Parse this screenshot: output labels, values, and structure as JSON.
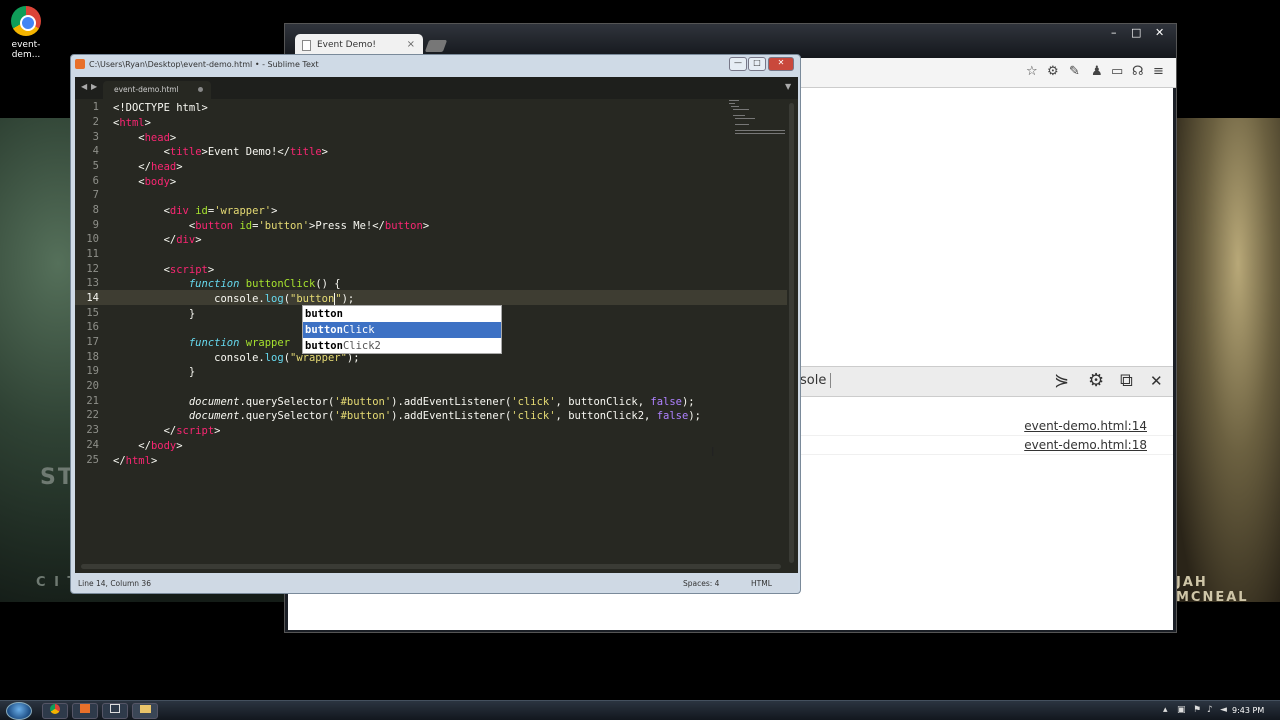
{
  "desktop": {
    "icon_label": "event-dem...",
    "wallpaper_text_left": "ST",
    "wallpaper_text_left2": "C I T",
    "wallpaper_text_right": "JAH MCNEAL"
  },
  "chrome": {
    "tab_title": "Event Demo!",
    "tab_close": "×",
    "win_min": "–",
    "win_max": "□",
    "win_close": "✕",
    "devtools": {
      "tab_label": "sole",
      "logs": [
        {
          "source": "event-demo.html:14"
        },
        {
          "source": "event-demo.html:18"
        }
      ]
    }
  },
  "sublime": {
    "title": "C:\\Users\\Ryan\\Desktop\\event-demo.html • - Sublime Text",
    "file_tab": "event-demo.html",
    "nav_back": "◀",
    "nav_fwd": "▶",
    "tab_dropdown": "▼",
    "btn_min": "—",
    "btn_max": "□",
    "btn_close": "✕",
    "line_numbers": [
      "1",
      "2",
      "3",
      "4",
      "5",
      "6",
      "7",
      "8",
      "9",
      "10",
      "11",
      "12",
      "13",
      "14",
      "15",
      "16",
      "17",
      "18",
      "19",
      "20",
      "21",
      "22",
      "23",
      "24",
      "25"
    ],
    "autocomplete": [
      {
        "match": "button",
        "rest": ""
      },
      {
        "match": "button",
        "rest": "Click"
      },
      {
        "match": "button",
        "rest": "Click2"
      }
    ],
    "status": {
      "position": "Line 14, Column 36",
      "spaces": "Spaces: 4",
      "syntax": "HTML"
    }
  },
  "taskbar": {
    "clock": "9:43 PM"
  }
}
